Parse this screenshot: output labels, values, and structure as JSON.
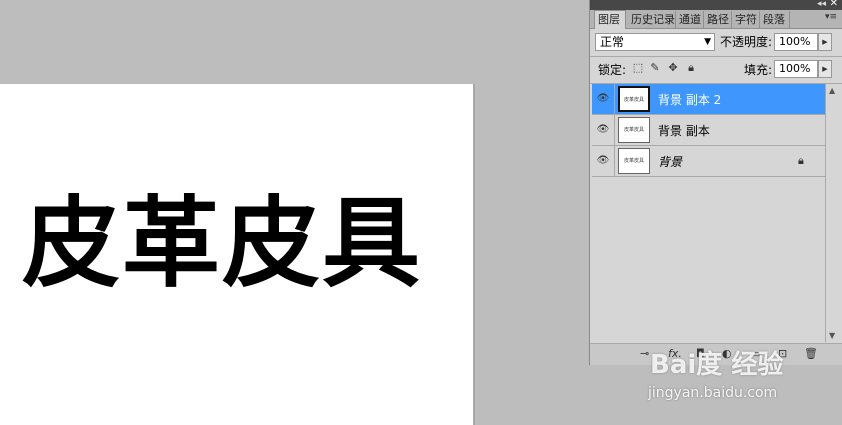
{
  "canvas": {
    "text": "皮革皮具"
  },
  "panel": {
    "tabs": [
      "图层",
      "历史记录",
      "通道",
      "路径",
      "字符",
      "段落"
    ],
    "blend_mode": "正常",
    "opacity_label": "不透明度:",
    "opacity_value": "100%",
    "lock_label": "锁定:",
    "fill_label": "填充:",
    "fill_value": "100%",
    "layers": [
      {
        "name": "背景 副本 2",
        "thumb": "皮革皮具",
        "selected": true
      },
      {
        "name": "背景 副本",
        "thumb": "皮革皮具",
        "selected": false
      },
      {
        "name": "背景",
        "thumb": "皮革皮具",
        "selected": false,
        "locked": true
      }
    ]
  },
  "watermark": {
    "logo": "Bai度 经验",
    "url": "jingyan.baidu.com"
  },
  "colors": {
    "selection": "#3f97fd",
    "panel_bg": "#d6d6d6",
    "workspace": "#bdbdbd"
  }
}
